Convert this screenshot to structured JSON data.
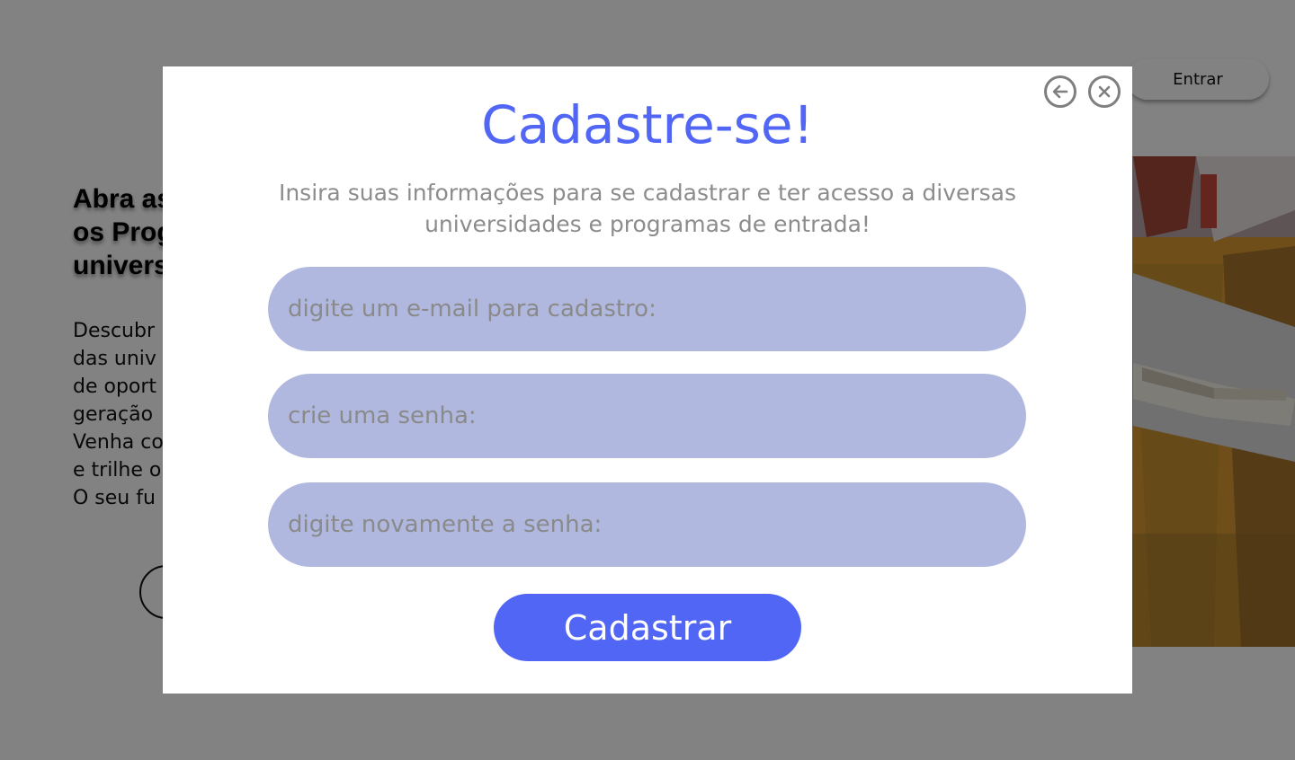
{
  "header": {
    "login_label": "Entrar"
  },
  "hero": {
    "title": "Abra as\nos Prog\nunivers",
    "text": "Descubr\ndas univ\nde oport\ngeração\nVenha co\ne trilhe o\nO seu fu"
  },
  "modal": {
    "title": "Cadastre-se!",
    "subtitle": "Insira suas informações para se cadastrar e ter acesso a diversas universidades e programas de entrada!",
    "back_icon": "arrow-left-circle-icon",
    "close_icon": "x-circle-icon",
    "fields": {
      "email_placeholder": "digite um e-mail para cadastro:",
      "password_placeholder": "crie uma senha:",
      "confirm_placeholder": "digite novamente a senha:"
    },
    "submit_label": "Cadastrar"
  },
  "colors": {
    "accent": "#5166F5",
    "field_background": "#B1B8DF",
    "overlay": "rgba(0,0,0,0.49)",
    "icon_gray": "#7F7F7F"
  }
}
